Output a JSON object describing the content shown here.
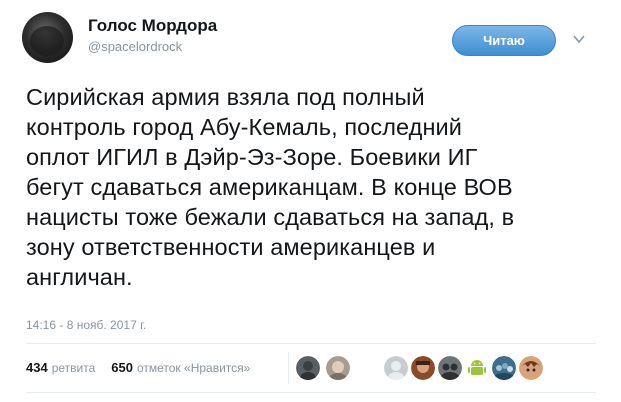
{
  "author": {
    "display_name": "Голос Мордора",
    "handle": "@spacelordrock"
  },
  "follow_button": {
    "label": "Читаю"
  },
  "tweet": {
    "lines": [
      "Сирийская армия взяла под полный",
      "контроль город Абу-Кемаль, последний",
      "оплот ИГИЛ в Дэйр-Эз-Зоре. Боевики ИГ",
      "бегут сдаваться американцам. В конце ВОВ",
      "нацисты тоже бежали сдаваться на запад, в",
      "зону ответственности американцев и",
      "англичан."
    ],
    "timestamp": "14:16 - 8 нояб. 2017 г."
  },
  "stats": {
    "retweets_count": "434",
    "retweets_label": "ретвита",
    "likes_count": "650",
    "likes_label": "отметок «Нравится»"
  },
  "likers": [
    {
      "icon": "avatar-gray",
      "color": "#5a5f63"
    },
    {
      "icon": "avatar-face",
      "color": "#a89c90"
    },
    {
      "icon": "avatar-default",
      "color": "#c7ccd1"
    },
    {
      "icon": "avatar-portrait",
      "color": "#8a4b2a"
    },
    {
      "icon": "avatar-group",
      "color": "#6f7478"
    },
    {
      "icon": "android-icon",
      "color": "#9bc63b"
    },
    {
      "icon": "avatar-crowd",
      "color": "#3e6f8a"
    },
    {
      "icon": "avatar-anime",
      "color": "#d8a27a"
    }
  ],
  "colors": {
    "accent": "#3f8fd2",
    "muted": "#8a959e",
    "text": "#14171a"
  }
}
